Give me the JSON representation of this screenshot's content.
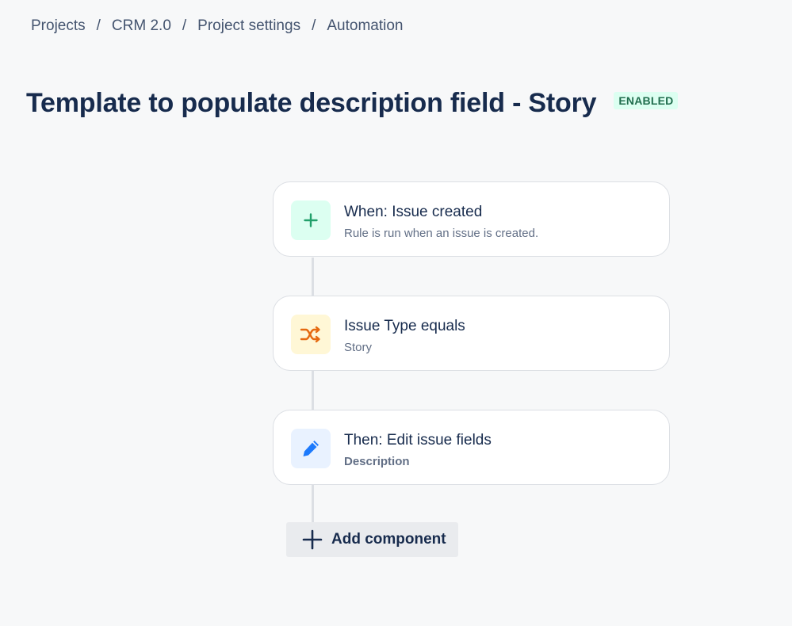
{
  "breadcrumb": {
    "items": [
      "Projects",
      "CRM 2.0",
      "Project settings",
      "Automation"
    ],
    "separator": "/"
  },
  "header": {
    "title": "Template to populate description field - Story",
    "status": "ENABLED"
  },
  "rule": {
    "trigger": {
      "icon": "plus-icon",
      "title": "When: Issue created",
      "subtitle": "Rule is run when an issue is created."
    },
    "condition": {
      "icon": "shuffle-icon",
      "title": "Issue Type equals",
      "subtitle": "Story"
    },
    "action": {
      "icon": "pencil-icon",
      "title": "Then: Edit issue fields",
      "subtitle": "Description"
    }
  },
  "add_component": {
    "icon": "plus-icon",
    "label": "Add component"
  },
  "colors": {
    "trigger_accent": "#22a06b",
    "condition_accent": "#e56910",
    "action_accent": "#1d7afc",
    "status_badge_bg": "#dcfff1",
    "status_badge_text": "#216e4e"
  }
}
